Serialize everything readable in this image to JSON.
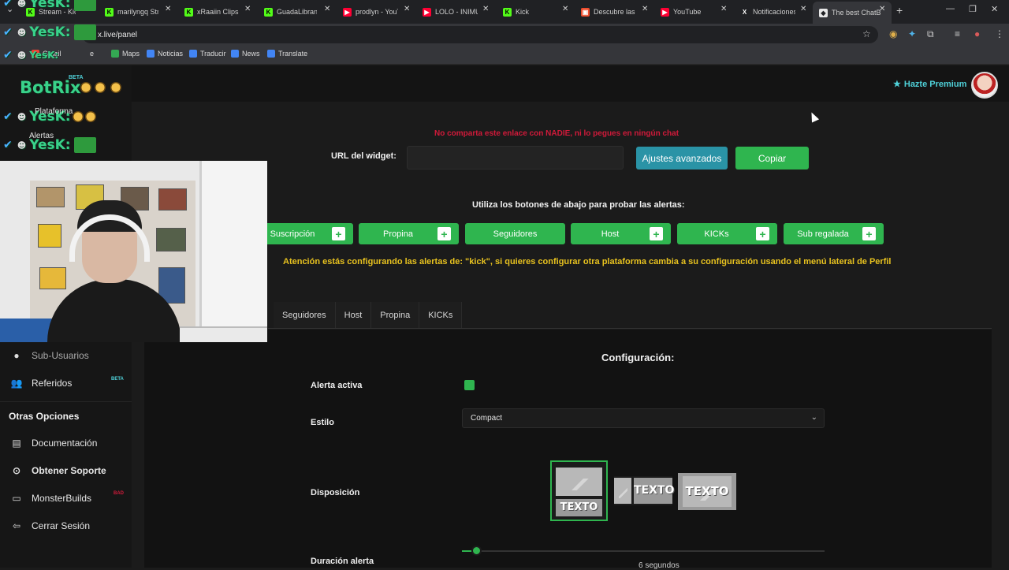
{
  "browser": {
    "tabs": [
      {
        "label": "Stream - Kick",
        "fav_color": "#53fc18",
        "fav_glyph": "K"
      },
      {
        "label": "marilyngq Stre",
        "fav_color": "#53fc18",
        "fav_glyph": "K"
      },
      {
        "label": "xRaaiin Clips -",
        "fav_color": "#53fc18",
        "fav_glyph": "K"
      },
      {
        "label": "GuadaLibrandi",
        "fav_color": "#53fc18",
        "fav_glyph": "K"
      },
      {
        "label": "prodlyn - YouT",
        "fav_color": "#ff0033",
        "fav_glyph": "▶"
      },
      {
        "label": "LOLO - INIMU",
        "fav_color": "#ff0033",
        "fav_glyph": "▶"
      },
      {
        "label": "Kick",
        "fav_color": "#53fc18",
        "fav_glyph": "K"
      },
      {
        "label": "Descubre las c",
        "fav_color": "#ee4d2d",
        "fav_glyph": "▣"
      },
      {
        "label": "YouTube",
        "fav_color": "#ff0033",
        "fav_glyph": "▶"
      },
      {
        "label": "Notificaciones",
        "fav_color": "#202124",
        "fav_glyph": "X"
      },
      {
        "label": "The best ChatB",
        "fav_color": "#e8e8e8",
        "fav_glyph": "◆"
      }
    ],
    "url": "x.live/panel",
    "bookmarks": [
      {
        "label": "Gmail",
        "fav_color": "#ea4335"
      },
      {
        "label": "e",
        "fav_color": "#4285f4"
      },
      {
        "label": "Maps",
        "fav_color": "#34a853"
      },
      {
        "label": "Noticias",
        "fav_color": "#4285f4"
      },
      {
        "label": "Traducir",
        "fav_color": "#4285f4"
      },
      {
        "label": "News",
        "fav_color": "#4285f4"
      },
      {
        "label": "Translate",
        "fav_color": "#4285f4"
      }
    ]
  },
  "overlay": {
    "chat_word": "YesK:",
    "logo": "BotRix",
    "logo_badge": "BETA",
    "labels": [
      "Plataforma",
      "Alertas"
    ]
  },
  "header": {
    "premium_label": "Hazte Premium",
    "premium_icon": "star-icon"
  },
  "widget": {
    "warning": "No comparta este enlace con NADIE, ni lo pegues en ningún chat",
    "label": "URL del widget:",
    "url_value": "",
    "advanced_button": "Ajustes avanzados",
    "copy_button": "Copiar"
  },
  "test_alerts": {
    "title": "Utiliza los botones de abajo para probar las alertas:",
    "buttons": [
      "Suscripción",
      "Propina",
      "Seguidores",
      "Host",
      "KICKs",
      "Sub regalada"
    ],
    "attention": "Atención estás configurando las alertas de: \"kick\", si quieres configurar otra plataforma cambia a su configuración usando el menú lateral de Perfil"
  },
  "config_tabs": [
    "Seguidores",
    "Host",
    "Propina",
    "KICKs"
  ],
  "config": {
    "title": "Configuración:",
    "alert_active_label": "Alerta activa",
    "alert_active": true,
    "style_label": "Estilo",
    "style_value": "Compact",
    "layout_label": "Disposición",
    "layout_text": "TEXTO",
    "duration_label": "Duración alerta",
    "duration_value": "6 segundos",
    "duration_fraction": 0.04
  },
  "sidebar": {
    "items": [
      {
        "label": "Sub-Usuarios",
        "icon": "users-icon",
        "glyph": "●"
      },
      {
        "label": "Referidos",
        "icon": "referrals-icon",
        "glyph": "👥",
        "badge": "BETA"
      }
    ],
    "section_title": "Otras Opciones",
    "other_items": [
      {
        "label": "Documentación",
        "icon": "book-icon",
        "glyph": "▤"
      },
      {
        "label": "Obtener Soporte",
        "icon": "support-icon",
        "glyph": "⊙"
      },
      {
        "label": "MonsterBuilds",
        "icon": "laptop-icon",
        "glyph": "▭",
        "badge": "BAD"
      },
      {
        "label": "Cerrar Sesión",
        "icon": "logout-icon",
        "glyph": "⇦"
      }
    ]
  },
  "colors": {
    "accent_green": "#2fb54f",
    "accent_teal": "#2a93a6",
    "premium_cyan": "#4fd1d9",
    "warning_red": "#d11a3a",
    "attention_yellow": "#e8c21f"
  }
}
